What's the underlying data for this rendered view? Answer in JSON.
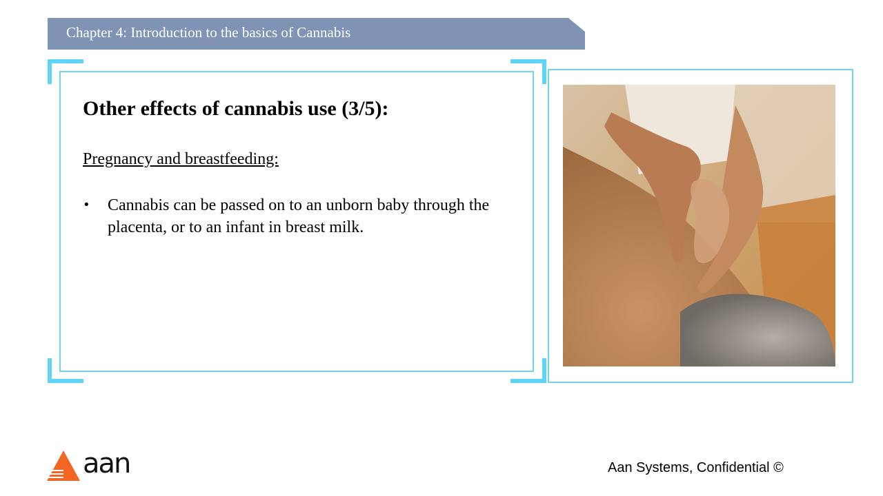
{
  "header": {
    "chapter_title": "Chapter 4: Introduction to the basics of Cannabis"
  },
  "slide": {
    "heading": "Other effects of cannabis use (3/5):",
    "section_heading": "Pregnancy and breastfeeding:",
    "bullets": [
      {
        "marker": "•",
        "text": "Cannabis can be passed on to an unborn baby through the placenta, or to an infant in breast milk."
      }
    ]
  },
  "image": {
    "subject": "massage-photo"
  },
  "footer": {
    "logo_text": "aan",
    "confidential": "Aan Systems, Confidential ©"
  },
  "colors": {
    "banner": "#7f93b5",
    "frame_accent": "#5fd3f3",
    "logo_orange": "#f26522"
  }
}
